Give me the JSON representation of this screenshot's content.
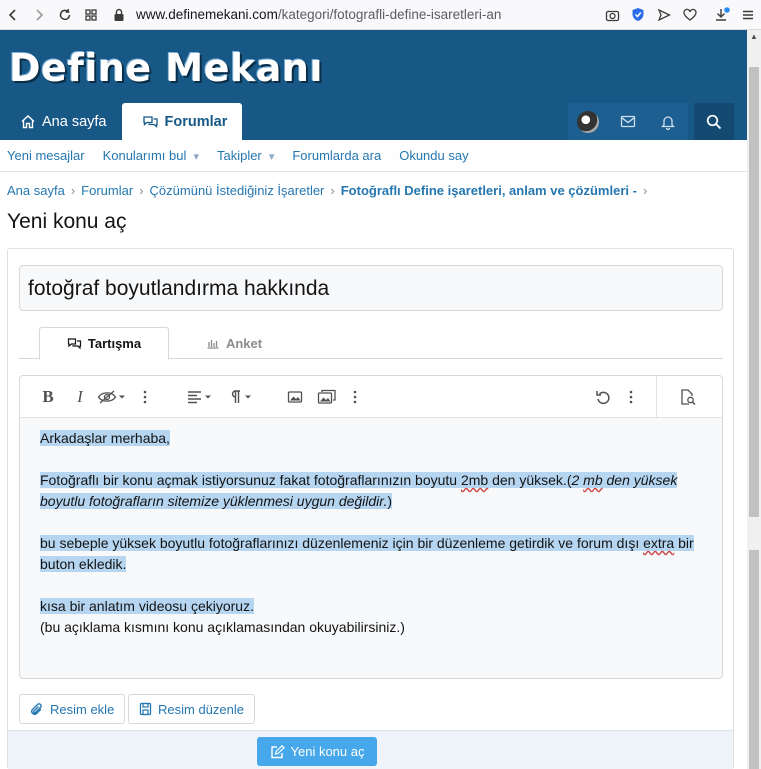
{
  "browser": {
    "url_domain": "www.definemekani.com",
    "url_path": "/kategori/fotografli-define-isaretleri-an"
  },
  "site": {
    "logo": "Define Mekanı",
    "nav": [
      {
        "label": "Ana sayfa"
      },
      {
        "label": "Forumlar"
      }
    ]
  },
  "subnav": {
    "items": [
      "Yeni mesajlar",
      "Konularımı bul",
      "Takipler",
      "Forumlarda ara",
      "Okundu say"
    ]
  },
  "breadcrumb": {
    "items": [
      "Ana sayfa",
      "Forumlar",
      "Çözümünü İstediğiniz İşaretler",
      "Fotoğraflı Define işaretleri, anlam ve çözümleri -"
    ]
  },
  "page": {
    "title": "Yeni konu aç"
  },
  "form": {
    "thread_title": "fotoğraf boyutlandırma hakkında",
    "tabs": [
      "Tartışma",
      "Anket"
    ],
    "body": {
      "line1": "Arkadaşlar merhaba,",
      "line2a": "Fotoğraflı bir konu açmak istiyorsunuz fakat fotoğraflarınızın boyutu ",
      "line2b": "2mb",
      "line2c": " den yüksek.(",
      "line2d": "2 ",
      "line2e": "mb",
      "line2f": " den yüksek boyutlu fotoğrafların sitemize yüklenmesi uygun değildir.",
      "line2g": ")",
      "line3a": "bu sebeple yüksek boyutlu fotoğraflarınızı düzenlemeniz için bir düzenleme getirdik ve forum dışı ",
      "line3b": "extra",
      "line3c": " bir buton ekledik.",
      "line4": "kısa bir anlatım videosu çekiyoruz.",
      "line5": "(bu açıklama kısmını konu açıklamasından okuyabilirsiniz.)"
    },
    "attach_label": "Resim ekle",
    "edit_image_label": "Resim düzenle",
    "submit_label": "Yeni konu aç"
  },
  "colors": {
    "header": "#185886",
    "link": "#2577b1",
    "selection": "#b5d5f0",
    "primary_button": "#47a7eb"
  }
}
